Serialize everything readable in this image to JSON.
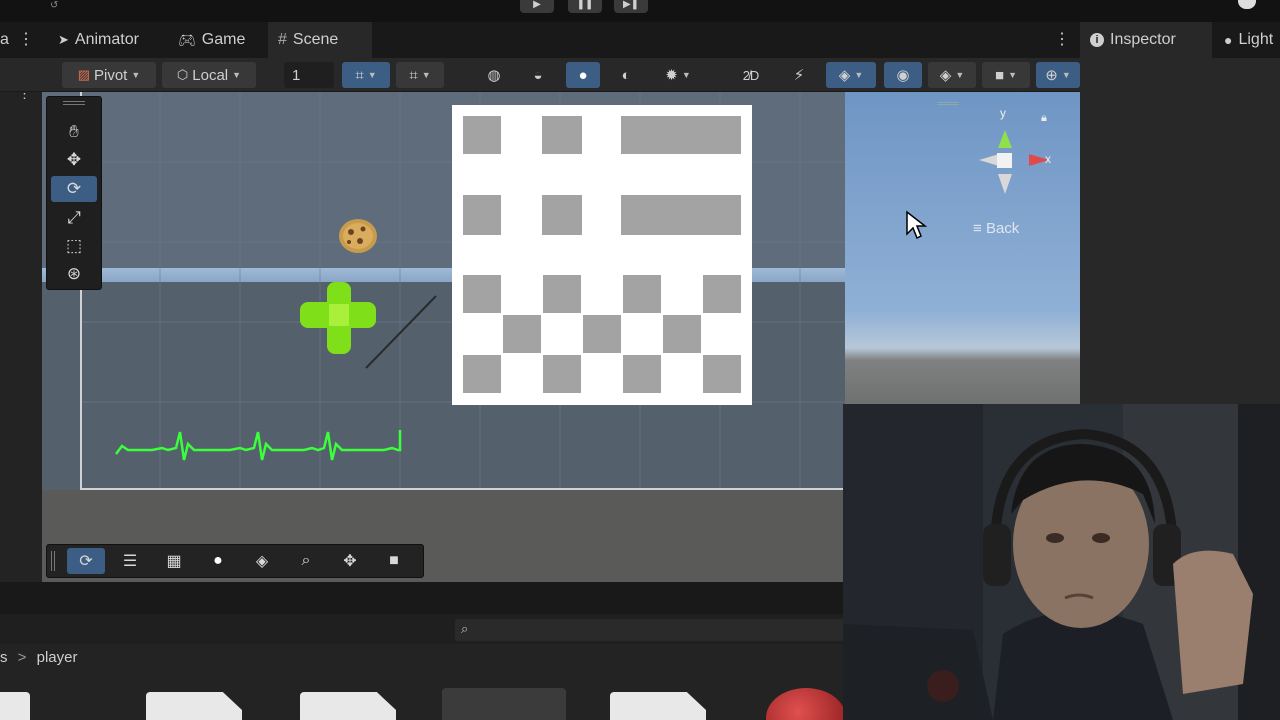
{
  "top": {
    "play": "▶",
    "pause": "❚❚",
    "step": "▶❚"
  },
  "tabs": [
    {
      "label": "Animator"
    },
    {
      "label": "Game"
    },
    {
      "label": "Scene"
    }
  ],
  "inspector_tabs": [
    {
      "label": "Inspector"
    },
    {
      "label": "Light"
    }
  ],
  "toolbar": {
    "pivot": "Pivot",
    "local": "Local",
    "grid_value": "1"
  },
  "gizmo": {
    "y": "y",
    "x": "x",
    "view": "Back"
  },
  "project": {
    "breadcrumb_prefix": "s",
    "breadcrumb_sep": ">",
    "breadcrumb_item": "player"
  },
  "colors": {
    "accent": "#3c5e85",
    "ecg": "#3cff3c",
    "cross": "#7fe01a"
  }
}
